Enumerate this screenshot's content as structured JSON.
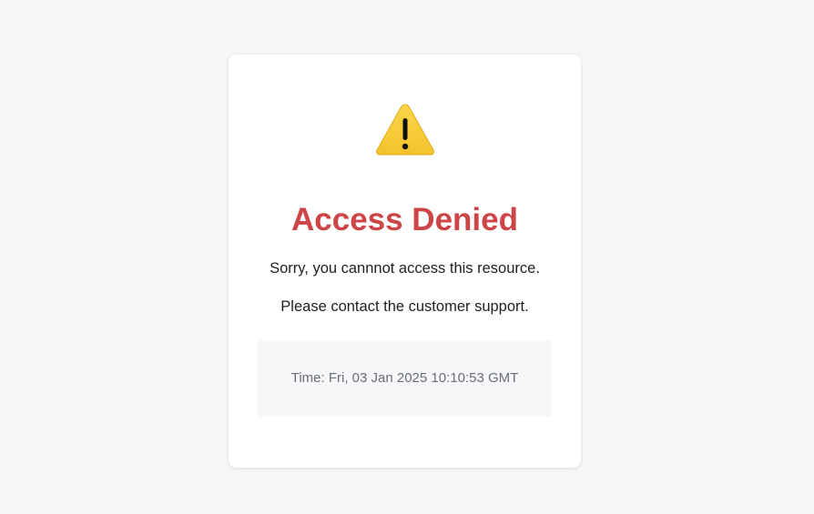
{
  "icon": {
    "name": "warning-icon",
    "color": "#f5c730"
  },
  "title": "Access Denied",
  "messages": [
    "Sorry, you cannnot access this resource.",
    "Please contact the customer support."
  ],
  "time": "Time: Fri, 03 Jan 2025 10:10:53 GMT",
  "colors": {
    "background": "#f5f6f8",
    "card": "#ffffff",
    "title": "#cd4546",
    "time_box": "#f6f7f9"
  }
}
